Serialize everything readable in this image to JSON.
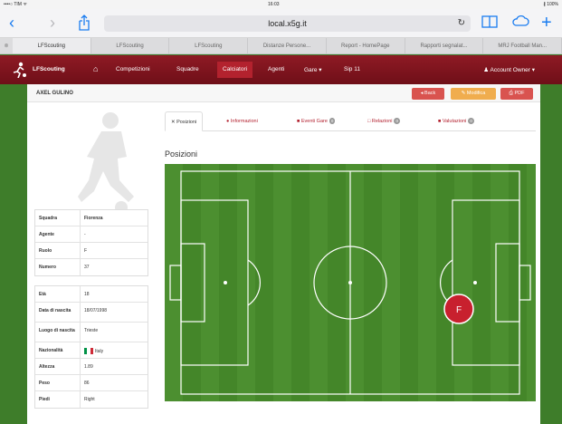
{
  "status_bar": {
    "left": "••••○ TIM ᯤ",
    "time": "16:03",
    "battery": "∦ 100%"
  },
  "browser": {
    "url": "local.x5g.it",
    "tabs": [
      "LFScouting",
      "LFScouting",
      "LFScouting",
      "Distanze Persone...",
      "Report - HomePage",
      "Rapporti segnalat...",
      "MRJ Football Man..."
    ]
  },
  "app_nav": {
    "brand": "LFScouting",
    "items": [
      "Competizioni",
      "Squadre",
      "Calciatori",
      "Agenti",
      "Gare ▾",
      "Sip 11"
    ],
    "active_index": 2,
    "account": "Account Owner ▾"
  },
  "page": {
    "title": "AXEL GULINO",
    "buttons": {
      "back": "◂ Back",
      "edit": "✎ Modifica",
      "pdf": "⎙ PDF"
    }
  },
  "info_top": [
    {
      "k": "Squadra",
      "v": "Fiorenza",
      "bold": true
    },
    {
      "k": "Agente",
      "v": "-"
    },
    {
      "k": "Ruolo",
      "v": "F"
    },
    {
      "k": "Numero",
      "v": "37"
    }
  ],
  "info_bottom": [
    {
      "k": "Età",
      "v": "18"
    },
    {
      "k": "Data di nascita",
      "v": "18/07/1998"
    },
    {
      "k": "Luogo di nascita",
      "v": "Trieste"
    },
    {
      "k": "Nazionalità",
      "v": "Italy",
      "flag": true
    },
    {
      "k": "Altezza",
      "v": "1.89"
    },
    {
      "k": "Peso",
      "v": "86"
    },
    {
      "k": "Piedi",
      "v": "Right"
    }
  ],
  "content_tabs": [
    {
      "label": "Posizioni",
      "icon": "✕"
    },
    {
      "label": "Informazioni",
      "icon": "●"
    },
    {
      "label": "Eventi Gare",
      "icon": "■",
      "badge": "0"
    },
    {
      "label": "Relazioni",
      "icon": "□",
      "badge": "0"
    },
    {
      "label": "Valutazioni",
      "icon": "■",
      "badge": "0"
    }
  ],
  "section_title": "Posizioni",
  "pitch": {
    "marker_label": "F",
    "marker_color": "#c8202e",
    "grass": "#4a8a2e"
  },
  "colors": {
    "brand": "#7d141d",
    "accent": "#c8202e",
    "warning": "#f0ad4e",
    "italy": [
      "#009246",
      "#ffffff",
      "#ce2b37"
    ]
  }
}
